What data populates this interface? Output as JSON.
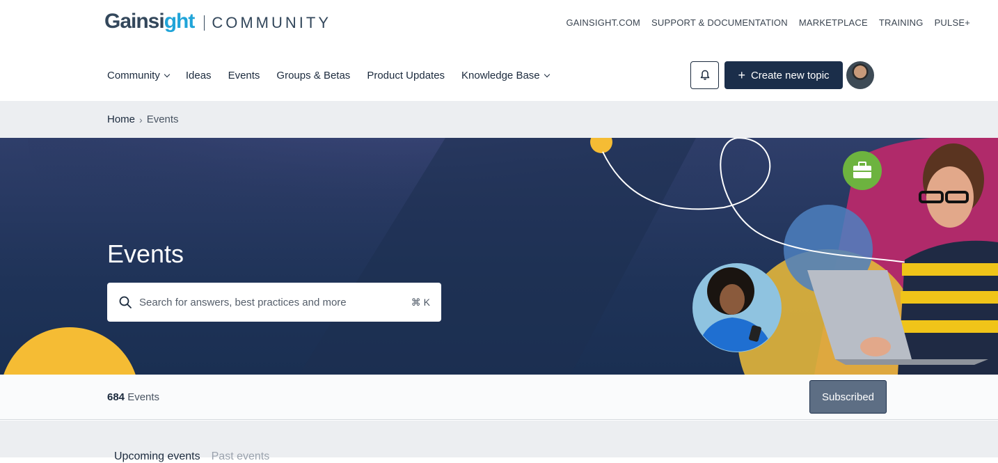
{
  "brand": {
    "logo_main": "Gainsight",
    "logo_sub": "COMMUNITY"
  },
  "utility_nav": [
    "GAINSIGHT.COM",
    "SUPPORT & DOCUMENTATION",
    "MARKETPLACE",
    "TRAINING",
    "PULSE+"
  ],
  "main_nav": {
    "community": "Community",
    "ideas": "Ideas",
    "events": "Events",
    "groups": "Groups & Betas",
    "product_updates": "Product Updates",
    "knowledge_base": "Knowledge Base"
  },
  "actions": {
    "create_topic": "Create new topic",
    "create_plus": "+"
  },
  "breadcrumb": {
    "home": "Home",
    "separator": "›",
    "current": "Events"
  },
  "hero": {
    "title": "Events",
    "search_placeholder": "Search for answers, best practices and more",
    "shortcut": "⌘ K"
  },
  "events_bar": {
    "count": "684",
    "count_label": "Events",
    "subscribe_label": "Subscribed"
  },
  "tabs": {
    "upcoming": "Upcoming events",
    "past": "Past events"
  },
  "colors": {
    "primary": "#1b2e4a",
    "accent": "#20a4d8",
    "subscribed_bg": "#5d6e84",
    "hero_yellow": "#f5bc34",
    "hero_green": "#6db33f"
  },
  "icons": [
    "bell-icon",
    "plus-icon",
    "search-icon",
    "briefcase-icon",
    "chevron-down-icon"
  ]
}
